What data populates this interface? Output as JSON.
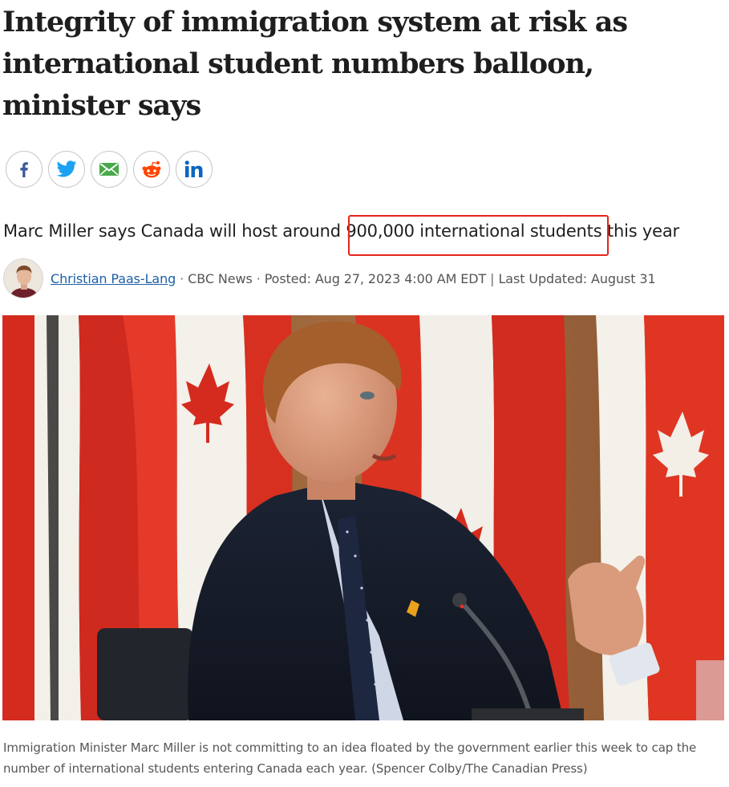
{
  "article": {
    "headline": "Integrity of immigration system at risk as international student numbers balloon, minister says",
    "deck": {
      "before": "Marc Miller says Canada will host around ",
      "highlighted": "900,000 international students",
      "after": " this year"
    },
    "highlight_color": "#e3261b"
  },
  "share": {
    "buttons": [
      {
        "icon": "facebook-icon",
        "color": "#3b5998"
      },
      {
        "icon": "twitter-icon",
        "color": "#1da1f2"
      },
      {
        "icon": "email-icon",
        "color": "#4aa94a"
      },
      {
        "icon": "reddit-icon",
        "color": "#ff4500"
      },
      {
        "icon": "linkedin-icon",
        "color": "#0a66c2"
      }
    ]
  },
  "byline": {
    "author": "Christian Paas-Lang",
    "separator": " · ",
    "outlet": "CBC News",
    "posted": "Posted: Aug 27, 2023 4:00 AM EDT",
    "divider": " | ",
    "updated": "Last Updated: August 31",
    "link_color": "#1c5fa8"
  },
  "photo": {
    "caption": "Immigration Minister Marc Miller is not committing to an idea floated by the government earlier this week to cap the number of international students entering Canada each year. (Spencer Colby/The Canadian Press)"
  }
}
